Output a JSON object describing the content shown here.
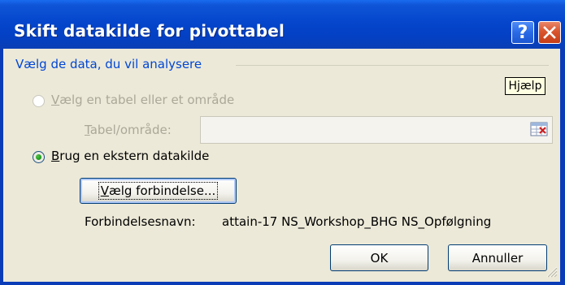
{
  "window": {
    "title": "Skift datakilde for pivottabel",
    "help_glyph": "?",
    "close_icon": "close-icon"
  },
  "group": {
    "legend": "Vælg de data, du vil analysere"
  },
  "tooltip": {
    "text": "Hjælp"
  },
  "option_table": {
    "label_prefix": "",
    "label_accel": "V",
    "label_rest": "ælg en tabel eller et område",
    "selected": false,
    "enabled": false
  },
  "range": {
    "label_prefix": "",
    "label_accel": "T",
    "label_rest": "abel/område:",
    "value": ""
  },
  "option_external": {
    "label_prefix": "",
    "label_accel": "B",
    "label_rest": "rug en ekstern datakilde",
    "selected": true,
    "enabled": true
  },
  "choose_connection": {
    "label_prefix": "",
    "label_accel": "V",
    "label_rest": "ælg forbindelse..."
  },
  "connection": {
    "label": "Forbindelsesnavn:",
    "value": "attain-17 NS_Workshop_BHG NS_Opfølgning"
  },
  "buttons": {
    "ok": "OK",
    "cancel": "Annuller"
  }
}
